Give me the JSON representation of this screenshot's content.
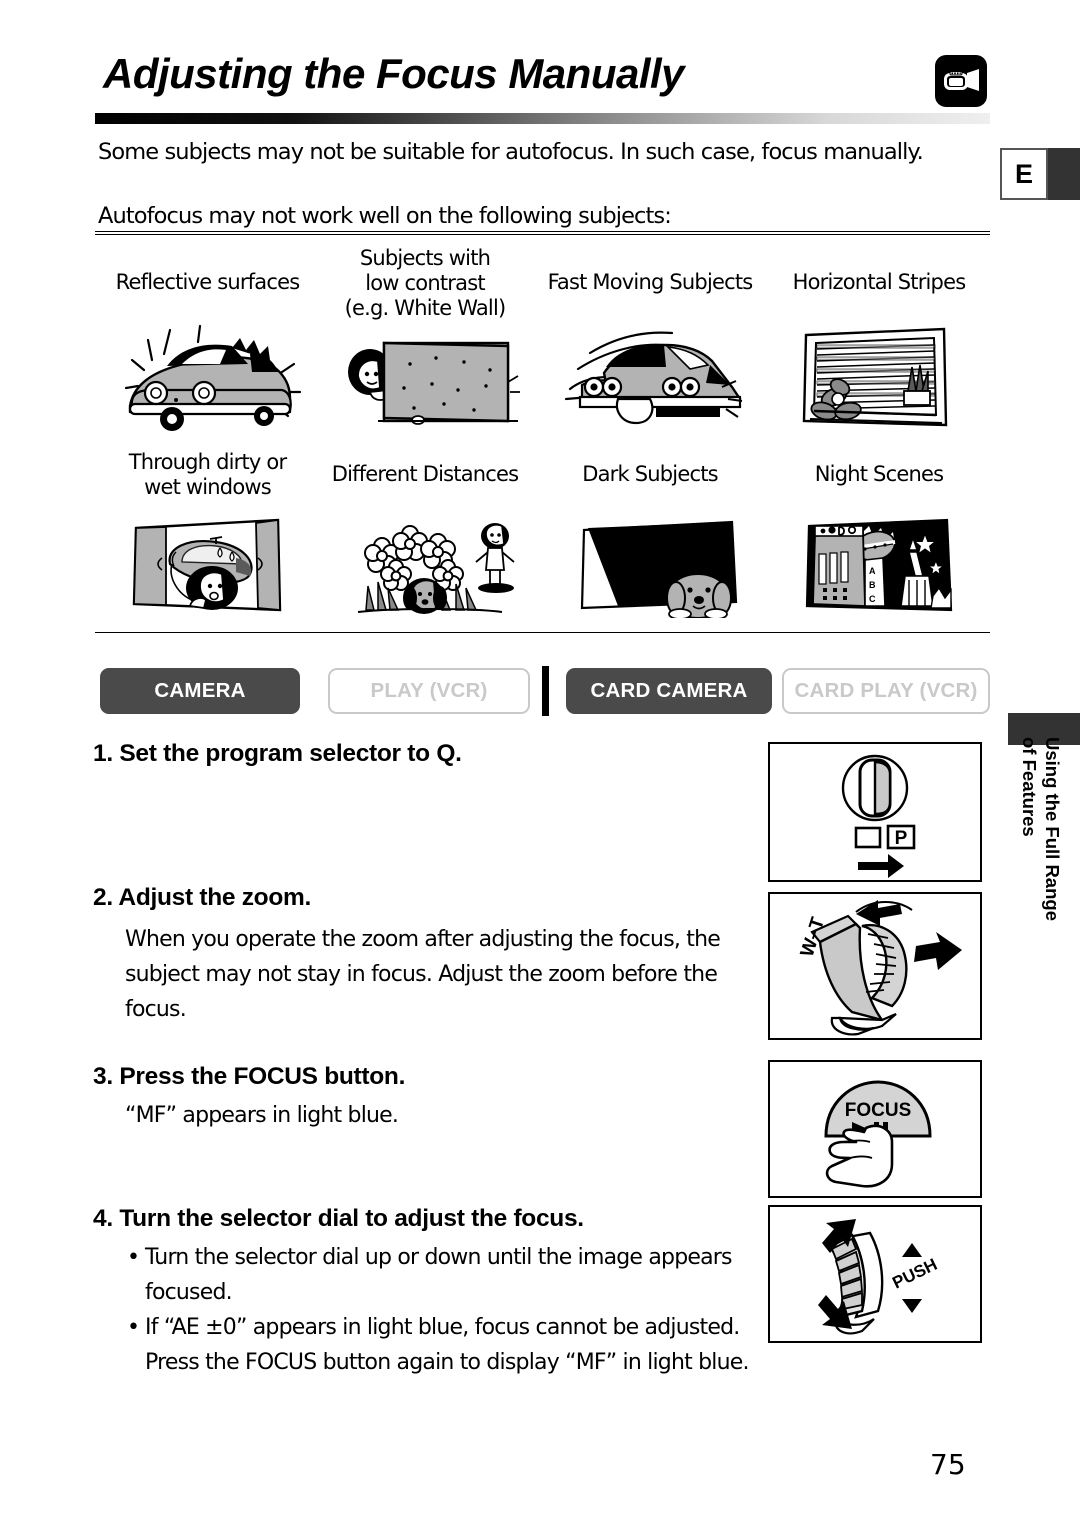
{
  "header": {
    "title": "Adjusting the Focus Manually",
    "icon": "camcorder-icon",
    "margin_tab": "E"
  },
  "intro": "Some subjects may not be suitable for autofocus. In such case, focus manually.",
  "subjects": {
    "heading": "Autofocus may not work well on the following subjects:",
    "row1": [
      {
        "label": "Reflective surfaces",
        "art": "shiny-car-illustration"
      },
      {
        "label": "Subjects with\nlow contrast\n(e.g. White Wall)",
        "art": "white-wall-illustration"
      },
      {
        "label": "Fast Moving Subjects",
        "art": "speeding-car-illustration"
      },
      {
        "label": "Horizontal Stripes",
        "art": "window-blinds-illustration"
      }
    ],
    "row2": [
      {
        "label": "Through dirty or\nwet windows",
        "art": "rainy-window-illustration"
      },
      {
        "label": "Different Distances",
        "art": "flowers-dog-person-illustration"
      },
      {
        "label": "Dark Subjects",
        "art": "dark-subject-dog-illustration"
      },
      {
        "label": "Night Scenes",
        "art": "night-city-illustration"
      }
    ]
  },
  "modes": [
    {
      "label": "CAMERA",
      "state": "on"
    },
    {
      "label": "PLAY (VCR)",
      "state": "off"
    },
    {
      "label": "CARD CAMERA",
      "state": "on"
    },
    {
      "label": "CARD PLAY (VCR)",
      "state": "off"
    }
  ],
  "steps": [
    {
      "heading": "1. Set the program selector to Q.",
      "body": [],
      "diagram": "program-selector-dial-diagram",
      "diagram_labels": [
        "P"
      ]
    },
    {
      "heading": "2. Adjust the zoom.",
      "body": [
        "When you operate the zoom after adjusting the focus, the",
        "subject may not stay in focus. Adjust the zoom before the focus."
      ],
      "diagram": "zoom-lever-diagram",
      "diagram_labels": [
        "W–T"
      ]
    },
    {
      "heading": "3. Press the FOCUS button.",
      "body": [
        "“MF” appears in light blue."
      ],
      "diagram": "focus-button-diagram",
      "diagram_labels": [
        "FOCUS"
      ]
    },
    {
      "heading": "4. Turn the selector dial to adjust the focus.",
      "bullets": [
        "Turn the selector dial up or down until the image appears focused.",
        "If “AE ±0” appears in light blue, focus cannot be adjusted. Press the FOCUS button again to display “MF” in light blue."
      ],
      "diagram": "selector-dial-push-diagram",
      "diagram_labels": [
        "PUSH"
      ]
    }
  ],
  "step4_lines": {
    "b1l1": "Turn the selector dial up or down until the image appears",
    "b1l2": "focused.",
    "b2l1": "If “AE ±0” appears in light blue, focus cannot be adjusted.",
    "b2l2": "Press the FOCUS button again to display “MF” in light blue."
  },
  "chapter_tab": "Using the Full Range\nof Features",
  "page_number": "75",
  "colors": {
    "tab_on_bg": "#4a4a4a",
    "tab_off_border": "#c9c9c9",
    "margin_block": "#333333",
    "art_gray": "#b3b3b3"
  }
}
